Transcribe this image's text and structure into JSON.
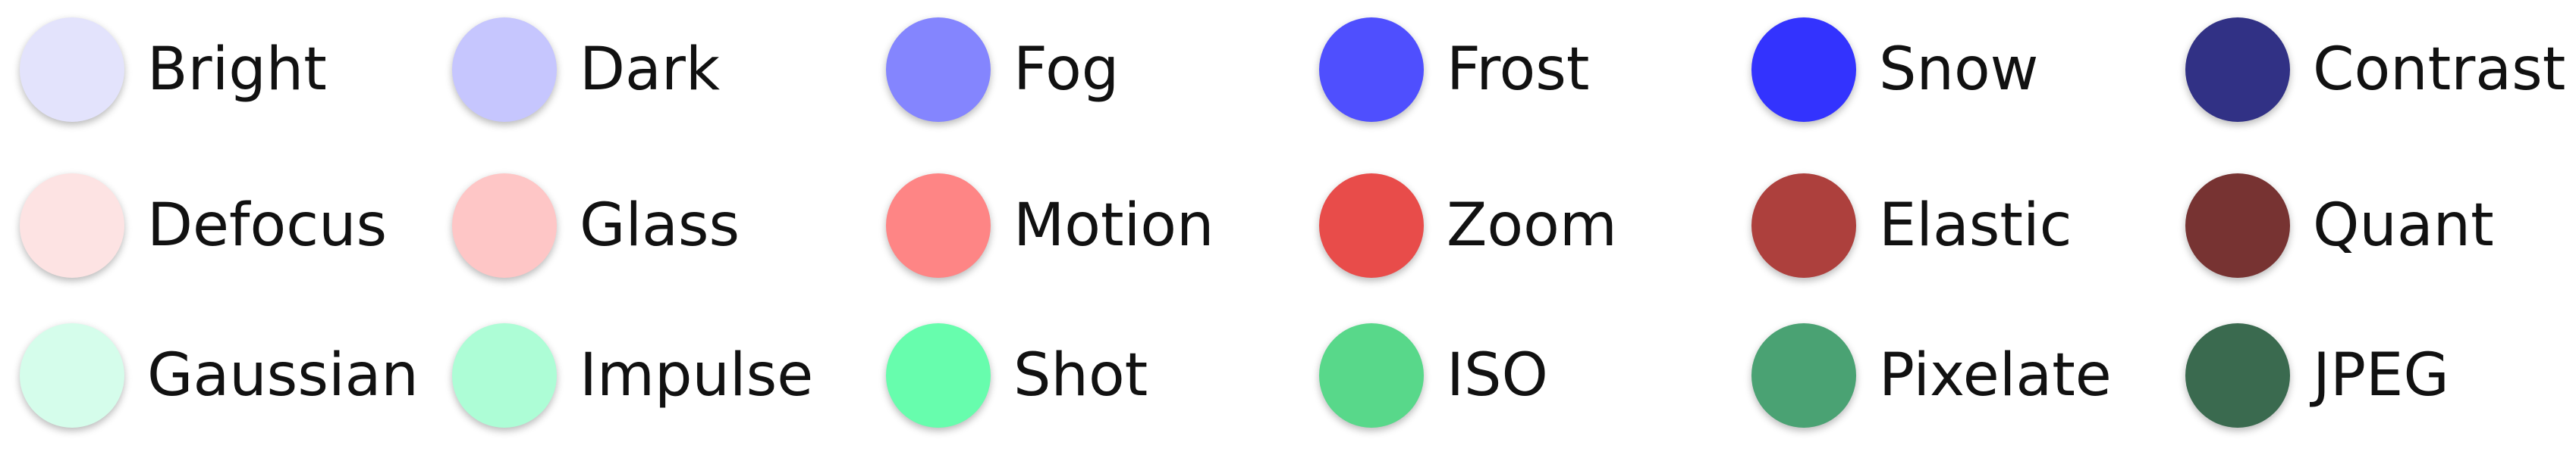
{
  "legend": {
    "rows": [
      {
        "items": [
          {
            "label": "Bright",
            "color": "#E3E3FC"
          },
          {
            "label": "Dark",
            "color": "#C6C6FE"
          },
          {
            "label": "Fog",
            "color": "#8485FE"
          },
          {
            "label": "Frost",
            "color": "#4F4FFE"
          },
          {
            "label": "Snow",
            "color": "#3333FE"
          },
          {
            "label": "Contrast",
            "color": "#313185"
          }
        ]
      },
      {
        "items": [
          {
            "label": "Defocus",
            "color": "#FDE3E3"
          },
          {
            "label": "Glass",
            "color": "#FEC6C6"
          },
          {
            "label": "Motion",
            "color": "#FE8585"
          },
          {
            "label": "Zoom",
            "color": "#E84C4A"
          },
          {
            "label": "Elastic",
            "color": "#AD403D"
          },
          {
            "label": "Quant",
            "color": "#773332"
          }
        ]
      },
      {
        "items": [
          {
            "label": "Gaussian",
            "color": "#D5FDEB"
          },
          {
            "label": "Impulse",
            "color": "#ADFDD6"
          },
          {
            "label": "Shot",
            "color": "#67FDAD"
          },
          {
            "label": "ISO",
            "color": "#58D88A"
          },
          {
            "label": "Pixelate",
            "color": "#4AA273"
          },
          {
            "label": "JPEG",
            "color": "#3A6A4F"
          }
        ]
      }
    ]
  }
}
